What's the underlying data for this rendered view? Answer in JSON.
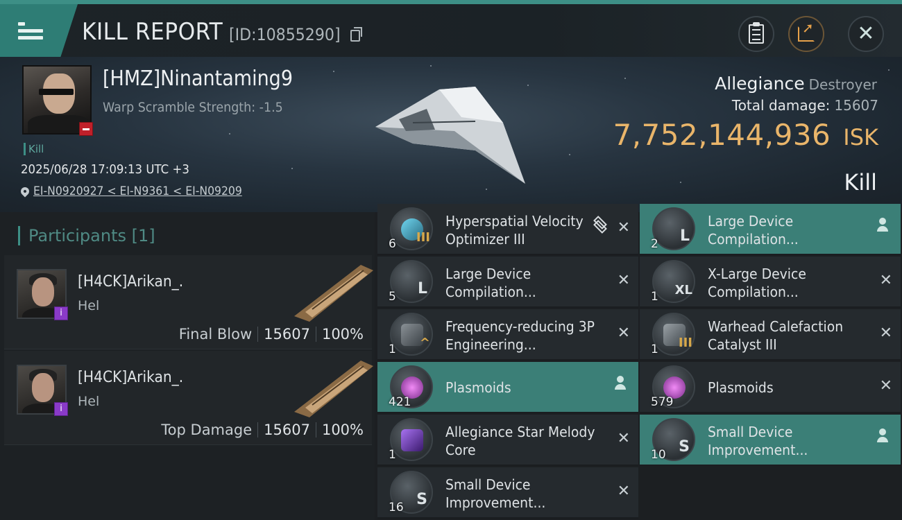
{
  "header": {
    "title": "KILL REPORT",
    "report_id": "[ID:10855290]"
  },
  "victim": {
    "name": "[HMZ]Ninantaming9",
    "warp_scramble": "Warp Scramble Strength: -1.5",
    "tag": "Kill",
    "timestamp": "2025/06/28 17:09:13 UTC +3",
    "location": "EI-N0920927 < EI-N9361 < EI-N09209",
    "ship_name": "Allegiance",
    "ship_class": "Destroyer",
    "total_damage_label": "Total damage:",
    "total_damage": "15607",
    "isk_value": "7,752,144,936",
    "isk_unit": "ISK",
    "outcome": "Kill"
  },
  "participants": {
    "header": "Participants [1]",
    "rows": [
      {
        "name": "[H4CK]Arikan_.",
        "ship": "Hel",
        "label": "Final Blow",
        "damage": "15607",
        "percent": "100%"
      },
      {
        "name": "[H4CK]Arikan_.",
        "ship": "Hel",
        "label": "Top Damage",
        "damage": "15607",
        "percent": "100%"
      }
    ]
  },
  "items": [
    {
      "qty": "6",
      "name": "Hyperspatial Velocity Optimizer III",
      "status": "destroyed",
      "stack_icon": true
    },
    {
      "qty": "2",
      "name": "Large Device Compilation...",
      "status": "dropped"
    },
    {
      "qty": "5",
      "name": "Large Device Compilation...",
      "status": "destroyed"
    },
    {
      "qty": "1",
      "name": "X-Large Device Compilation...",
      "status": "destroyed"
    },
    {
      "qty": "1",
      "name": "Frequency-reducing 3P Engineering...",
      "status": "destroyed"
    },
    {
      "qty": "1",
      "name": "Warhead Calefaction Catalyst III",
      "status": "destroyed"
    },
    {
      "qty": "421",
      "name": "Plasmoids",
      "status": "dropped"
    },
    {
      "qty": "579",
      "name": "Plasmoids",
      "status": "destroyed"
    },
    {
      "qty": "1",
      "name": "Allegiance Star Melody Core",
      "status": "destroyed"
    },
    {
      "qty": "10",
      "name": "Small Device Improvement...",
      "status": "dropped"
    },
    {
      "qty": "16",
      "name": "Small Device Improvement...",
      "status": "destroyed"
    }
  ],
  "colors": {
    "accent": "#3d8f86",
    "dropped_row": "#3b7f77",
    "isk": "#e9b56a"
  }
}
